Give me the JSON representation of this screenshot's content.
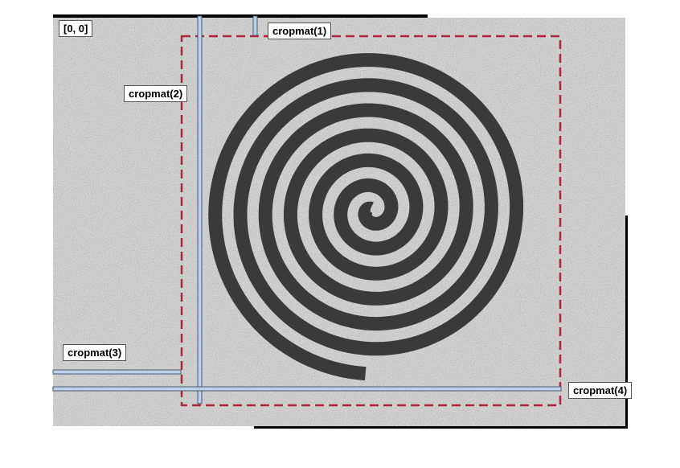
{
  "labels": {
    "origin": "[0, 0]",
    "crop1": "cropmat(1)",
    "crop2": "cropmat(2)",
    "crop3": "cropmat(3)",
    "crop4": "cropmat(4)"
  },
  "colors": {
    "background": "#ffffff",
    "noise_light": "#d4d4d4",
    "spiral": "#3a3a3a",
    "frame": "#000000",
    "crop_box": "#b0243a",
    "bar_fill": "#bcd0e8",
    "bar_stroke": "#4a5a72"
  },
  "spiral": {
    "turns": 6.5
  },
  "crop_box_style": "dashed"
}
